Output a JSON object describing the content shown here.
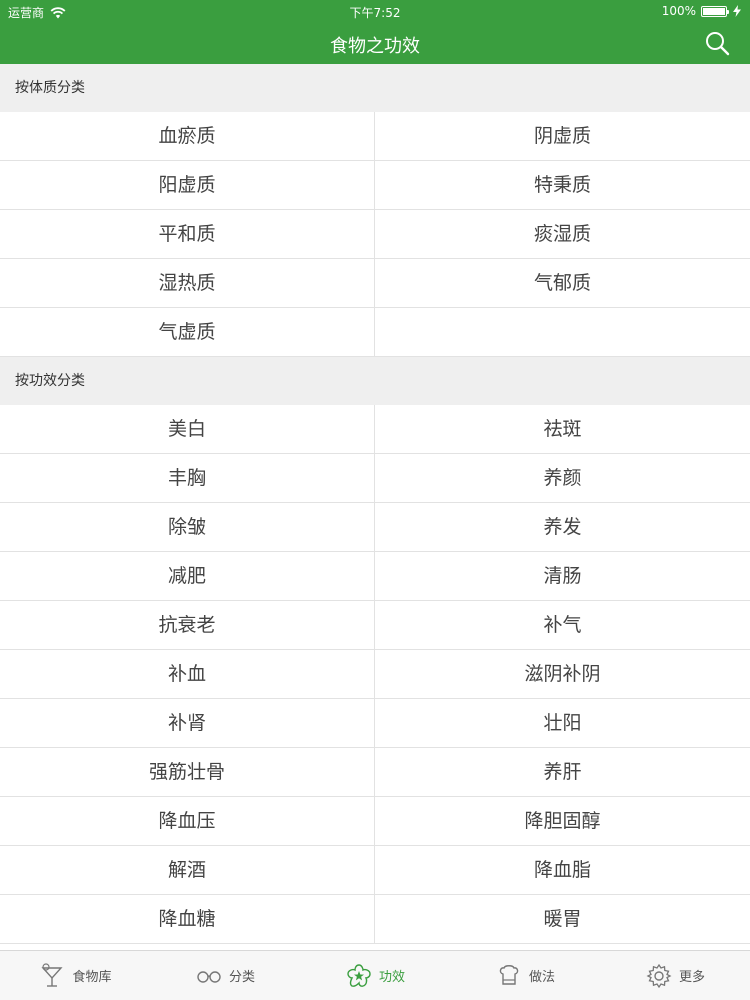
{
  "status_bar": {
    "carrier": "运营商",
    "time": "下午7:52",
    "battery": "100%",
    "battery_level": 1.0
  },
  "nav": {
    "title": "食物之功效",
    "search_icon": "search-icon"
  },
  "sections": [
    {
      "header": "按体质分类",
      "items": [
        "血瘀质",
        "阴虚质",
        "阳虚质",
        "特秉质",
        "平和质",
        "痰湿质",
        "湿热质",
        "气郁质",
        "气虚质",
        ""
      ]
    },
    {
      "header": "按功效分类",
      "items": [
        "美白",
        "祛斑",
        "丰胸",
        "养颜",
        "除皱",
        "养发",
        "减肥",
        "清肠",
        "抗衰老",
        "补气",
        "补血",
        "滋阴补阴",
        "补肾",
        "壮阳",
        "强筋壮骨",
        "养肝",
        "降血压",
        "降胆固醇",
        "解酒",
        "降血脂",
        "降血糖",
        "暖胃"
      ]
    }
  ],
  "tabs": [
    {
      "label": "食物库",
      "icon": "cocktail-glass-icon",
      "active": false
    },
    {
      "label": "分类",
      "icon": "glasses-icon",
      "active": false
    },
    {
      "label": "功效",
      "icon": "star-flower-icon",
      "active": true
    },
    {
      "label": "做法",
      "icon": "chef-hat-icon",
      "active": false
    },
    {
      "label": "更多",
      "icon": "gear-icon",
      "active": false
    }
  ],
  "colors": {
    "brand_green": "#3a9e3f",
    "section_bg": "#efefef",
    "divider": "#e2e2e2"
  }
}
